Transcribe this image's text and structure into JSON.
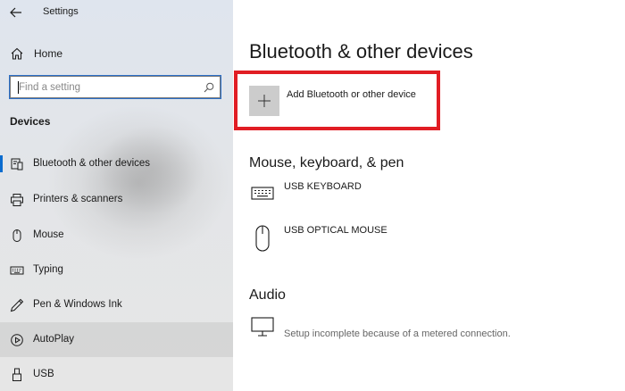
{
  "window": {
    "title": "Settings"
  },
  "sidebar": {
    "home_label": "Home",
    "search": {
      "placeholder": "Find a setting"
    },
    "section_title": "Devices",
    "items": [
      {
        "label": "Bluetooth & other devices",
        "icon": "bluetooth-devices-icon",
        "selected": true
      },
      {
        "label": "Printers & scanners",
        "icon": "printer-icon"
      },
      {
        "label": "Mouse",
        "icon": "mouse-icon"
      },
      {
        "label": "Typing",
        "icon": "keyboard-icon"
      },
      {
        "label": "Pen & Windows Ink",
        "icon": "pen-icon"
      },
      {
        "label": "AutoPlay",
        "icon": "autoplay-icon",
        "hovered": true
      },
      {
        "label": "USB",
        "icon": "usb-icon"
      }
    ]
  },
  "main": {
    "title": "Bluetooth & other devices",
    "add_device_label": "Add Bluetooth or other device",
    "groups": [
      {
        "title": "Mouse, keyboard, & pen",
        "devices": [
          {
            "name": "USB KEYBOARD",
            "icon": "keyboard-icon"
          },
          {
            "name": "USB OPTICAL MOUSE",
            "icon": "mouse-icon"
          }
        ]
      },
      {
        "title": "Audio",
        "devices": [
          {
            "name": "",
            "status": "Setup incomplete because of a metered connection.",
            "icon": "monitor-icon"
          }
        ]
      }
    ]
  },
  "colors": {
    "accent": "#0b6ccf",
    "highlight": "#e11d24",
    "plus_tile": "#cccccc"
  }
}
